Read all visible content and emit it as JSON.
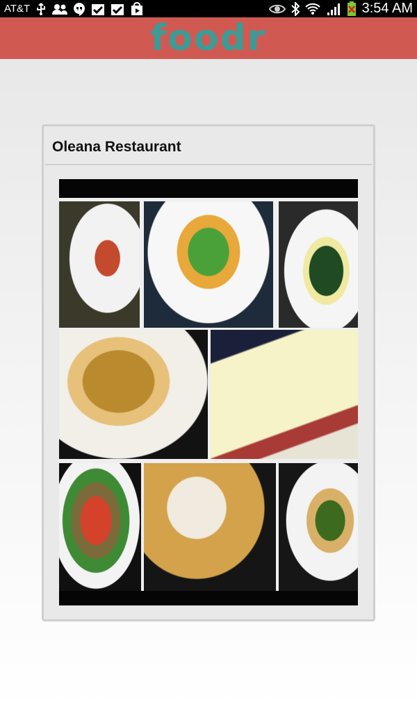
{
  "status_bar": {
    "carrier": "AT&T",
    "time": "3:54 AM",
    "icons": [
      "usb-icon",
      "people-icon",
      "hangouts-icon",
      "checkbox-icon",
      "checkbox-icon",
      "play-store-icon",
      "eye-icon",
      "bluetooth-icon",
      "wifi-icon",
      "signal-icon",
      "battery-icon"
    ]
  },
  "app_bar": {
    "logo_text": "foodr",
    "background": "#d05a52",
    "logo_color": "#3d9b96"
  },
  "card": {
    "title": "Oleana Restaurant",
    "photo_alt": "food collage"
  }
}
